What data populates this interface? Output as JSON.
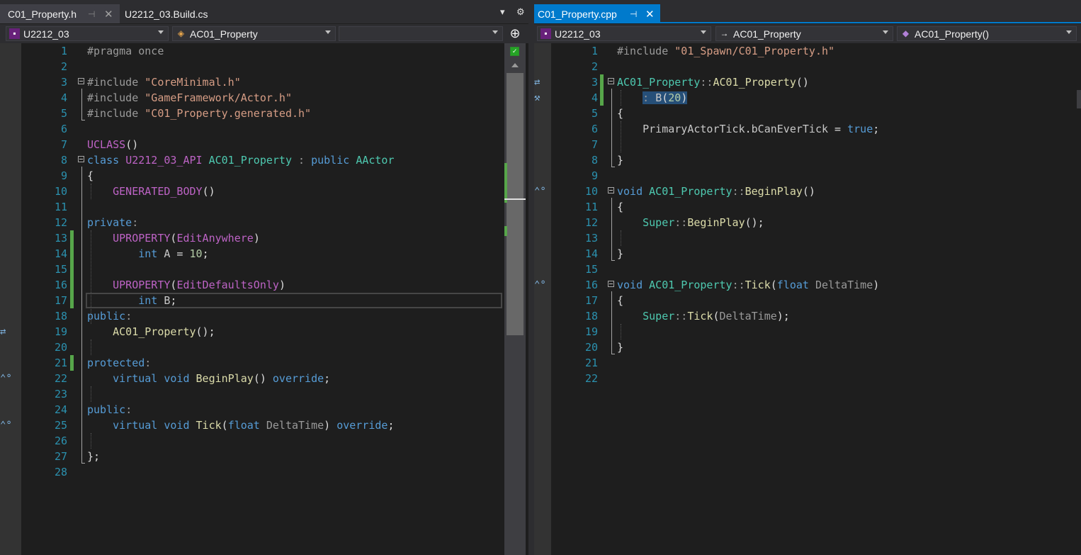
{
  "left": {
    "tabs": [
      {
        "label": "C01_Property.h",
        "pin": "⊣",
        "close": "✕"
      },
      {
        "label": "U2212_03.Build.cs"
      }
    ],
    "nav": {
      "project": "U2212_03",
      "scope": "AC01_Property",
      "member": ""
    },
    "lines": [
      {
        "n": "1",
        "html": "<span class=\"pp\">#pragma once</span>"
      },
      {
        "n": "2",
        "html": ""
      },
      {
        "n": "3",
        "html": "<span class=\"pp\">#include</span> <span class=\"str\">\"CoreMinimal.h\"</span>"
      },
      {
        "n": "4",
        "html": "<span class=\"pp\">#include</span> <span class=\"str\">\"GameFramework/Actor.h\"</span>"
      },
      {
        "n": "5",
        "html": "<span class=\"pp\">#include</span> <span class=\"str\">\"C01_Property.generated.h\"</span>"
      },
      {
        "n": "6",
        "html": ""
      },
      {
        "n": "7",
        "html": "<span class=\"mac\">UCLASS</span>()"
      },
      {
        "n": "8",
        "html": "<span class=\"kw\">class</span> <span class=\"mac\">U2212_03_API</span> <span class=\"typ\">AC01_Property</span> <span class=\"gray\">:</span> <span class=\"kw\">public</span> <span class=\"typ\">AActor</span>"
      },
      {
        "n": "9",
        "html": "{"
      },
      {
        "n": "10",
        "html": "    <span class=\"mac\">GENERATED_BODY</span>()"
      },
      {
        "n": "11",
        "html": ""
      },
      {
        "n": "12",
        "html": "<span class=\"kw\">private</span><span class=\"gray\">:</span>"
      },
      {
        "n": "13",
        "html": "    <span class=\"mac\">UPROPERTY</span>(<span class=\"mac\">EditAnywhere</span>)"
      },
      {
        "n": "14",
        "html": "        <span class=\"kw\">int</span> <span class=\"ident\">A</span> = <span class=\"num\">10</span>;"
      },
      {
        "n": "15",
        "html": ""
      },
      {
        "n": "16",
        "html": "    <span class=\"mac\">UPROPERTY</span>(<span class=\"mac\">EditDefaultsOnly</span>)"
      },
      {
        "n": "17",
        "html": "        <span class=\"kw\">int</span> <span class=\"ident\">B</span>;"
      },
      {
        "n": "18",
        "html": "<span class=\"kw\">public</span><span class=\"gray\">:</span>"
      },
      {
        "n": "19",
        "html": "    <span class=\"fn\">AC01_Property</span>();"
      },
      {
        "n": "20",
        "html": ""
      },
      {
        "n": "21",
        "html": "<span class=\"kw\">protected</span><span class=\"gray\">:</span>"
      },
      {
        "n": "22",
        "html": "    <span class=\"kw\">virtual</span> <span class=\"kw\">void</span> <span class=\"fn\">BeginPlay</span>() <span class=\"kw\">override</span>;"
      },
      {
        "n": "23",
        "html": ""
      },
      {
        "n": "24",
        "html": "<span class=\"kw\">public</span><span class=\"gray\">:</span>"
      },
      {
        "n": "25",
        "html": "    <span class=\"kw\">virtual</span> <span class=\"kw\">void</span> <span class=\"fn\">Tick</span>(<span class=\"kw\">float</span> <span class=\"parm\">DeltaTime</span>) <span class=\"kw\">override</span>;"
      },
      {
        "n": "26",
        "html": ""
      },
      {
        "n": "27",
        "html": "};"
      },
      {
        "n": "28",
        "html": ""
      }
    ]
  },
  "right": {
    "tabs": [
      {
        "label": "C01_Property.cpp",
        "pin": "⊣",
        "close": "✕"
      }
    ],
    "nav": {
      "project": "U2212_03",
      "scope": "AC01_Property",
      "member": "AC01_Property()"
    },
    "lines": [
      {
        "n": "1",
        "html": "<span class=\"pp\">#include</span> <span class=\"str\">\"01_Spawn/C01_Property.h\"</span>"
      },
      {
        "n": "2",
        "html": ""
      },
      {
        "n": "3",
        "html": "<span class=\"typ\">AC01_Property</span><span class=\"gray\">::</span><span class=\"fn\">AC01_Property</span>()"
      },
      {
        "n": "4",
        "html": "    <span class=\"sel\"><span class=\"gray\">:</span> <span class=\"ident\">B</span>(<span class=\"num\">20</span>)</span>"
      },
      {
        "n": "5",
        "html": "{"
      },
      {
        "n": "6",
        "html": "    <span class=\"ident\">PrimaryActorTick</span>.<span class=\"ident\">bCanEverTick</span> = <span class=\"kw\">true</span>;"
      },
      {
        "n": "7",
        "html": ""
      },
      {
        "n": "8",
        "html": "}"
      },
      {
        "n": "9",
        "html": ""
      },
      {
        "n": "10",
        "html": "<span class=\"kw\">void</span> <span class=\"typ\">AC01_Property</span><span class=\"gray\">::</span><span class=\"fn\">BeginPlay</span>()"
      },
      {
        "n": "11",
        "html": "{"
      },
      {
        "n": "12",
        "html": "    <span class=\"typ\">Super</span><span class=\"gray\">::</span><span class=\"fn\">BeginPlay</span>();"
      },
      {
        "n": "13",
        "html": ""
      },
      {
        "n": "14",
        "html": "}"
      },
      {
        "n": "15",
        "html": ""
      },
      {
        "n": "16",
        "html": "<span class=\"kw\">void</span> <span class=\"typ\">AC01_Property</span><span class=\"gray\">::</span><span class=\"fn\">Tick</span>(<span class=\"kw\">float</span> <span class=\"parm\">DeltaTime</span>)"
      },
      {
        "n": "17",
        "html": "{"
      },
      {
        "n": "18",
        "html": "    <span class=\"typ\">Super</span><span class=\"gray\">::</span><span class=\"fn\">Tick</span>(<span class=\"parm\">DeltaTime</span>);"
      },
      {
        "n": "19",
        "html": ""
      },
      {
        "n": "20",
        "html": "}"
      },
      {
        "n": "21",
        "html": ""
      },
      {
        "n": "22",
        "html": ""
      }
    ]
  },
  "toolbar": {
    "dropdown_glyph": "▾",
    "settings_glyph": "⚙",
    "split_glyph": "⊕"
  }
}
